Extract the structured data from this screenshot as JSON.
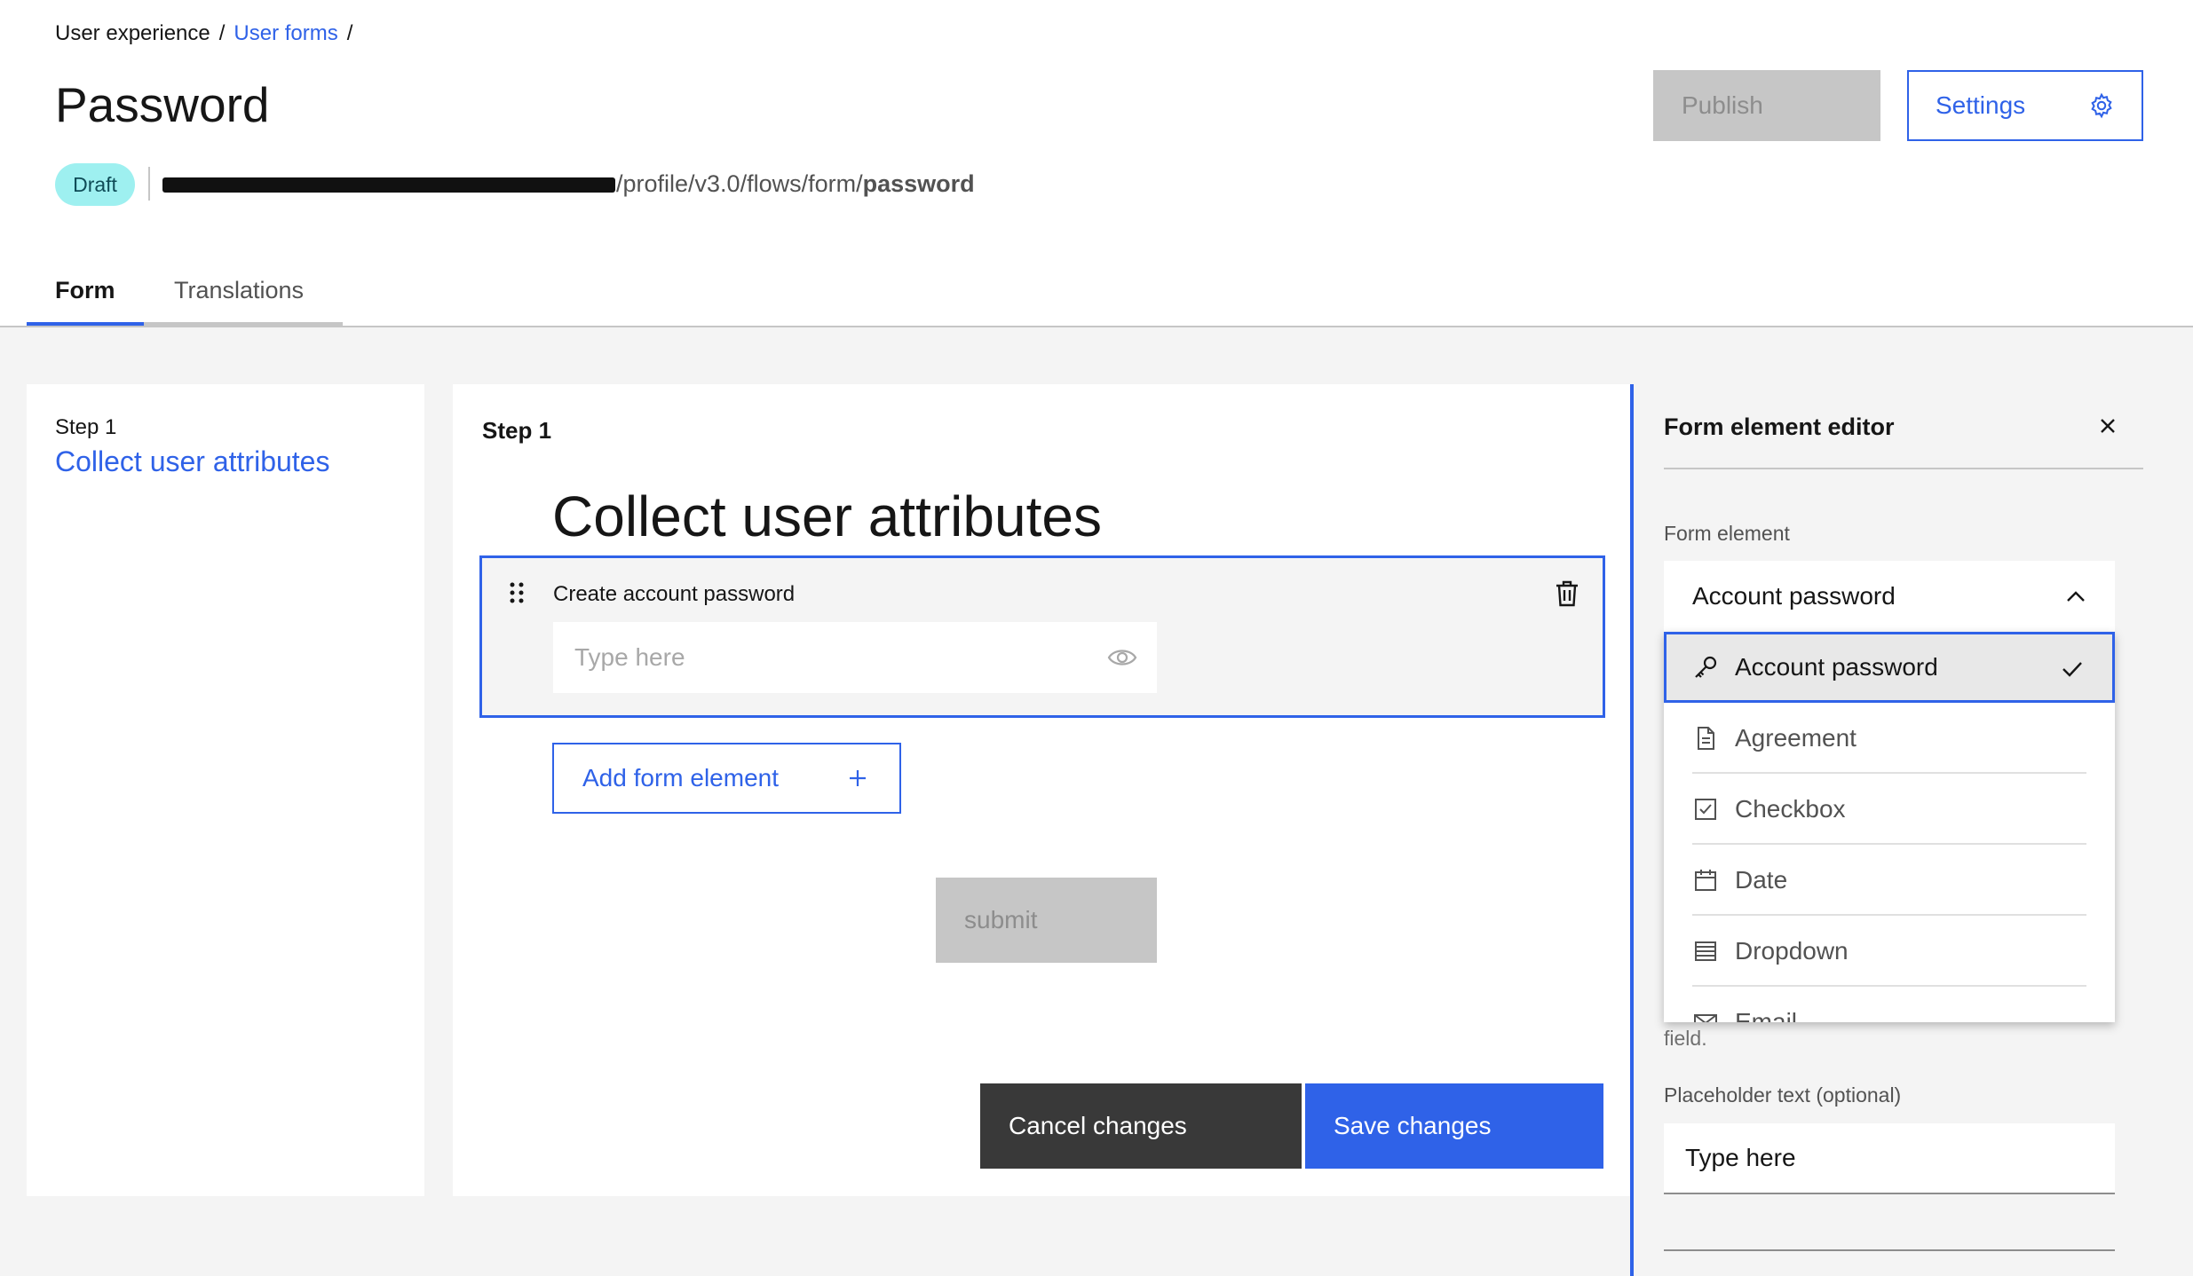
{
  "breadcrumb": {
    "items": [
      "User experience",
      "User forms"
    ],
    "sep": "/"
  },
  "header": {
    "title": "Password",
    "status_badge": "Draft",
    "url_suffix": "/profile/v3.0/flows/form/",
    "url_bold": "password",
    "publish_label": "Publish",
    "settings_label": "Settings"
  },
  "tabs": [
    {
      "label": "Form",
      "active": true
    },
    {
      "label": "Translations",
      "active": false
    }
  ],
  "steps_panel": {
    "step_label": "Step 1",
    "step_link": "Collect user attributes"
  },
  "canvas": {
    "step_label": "Step 1",
    "heading": "Collect user attributes",
    "element_label": "Create account password",
    "element_placeholder": "Type here",
    "add_label": "Add form element",
    "submit_label": "submit",
    "cancel_label": "Cancel changes",
    "save_label": "Save changes"
  },
  "editor": {
    "title": "Form element editor",
    "form_element_label": "Form element",
    "selected_value": "Account password",
    "options": [
      {
        "label": "Account password",
        "icon": "key-icon",
        "selected": true
      },
      {
        "label": "Agreement",
        "icon": "document-icon",
        "selected": false
      },
      {
        "label": "Checkbox",
        "icon": "checkbox-icon",
        "selected": false
      },
      {
        "label": "Date",
        "icon": "calendar-icon",
        "selected": false
      },
      {
        "label": "Dropdown",
        "icon": "list-icon",
        "selected": false
      },
      {
        "label": "Email",
        "icon": "email-icon",
        "selected": false
      }
    ],
    "helper_tail": "field.",
    "placeholder_label": "Placeholder text (optional)",
    "placeholder_value": "Type here"
  },
  "colors": {
    "accent": "#2f62e8",
    "draft_badge": "#9ef0f0",
    "dark_button": "#393939"
  }
}
